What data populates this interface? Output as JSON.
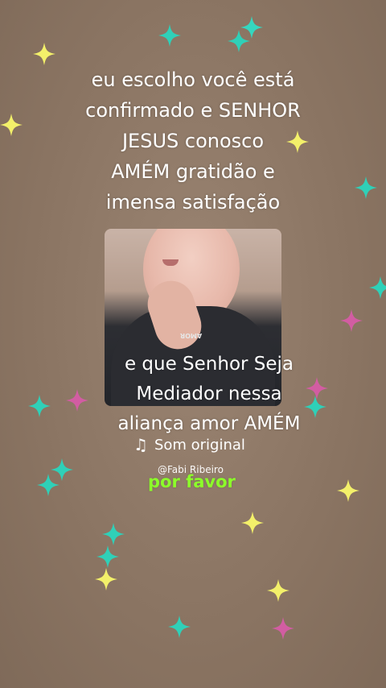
{
  "overlay_text": {
    "top": [
      "eu escolho você está",
      "confirmado e SENHOR",
      "JESUS conosco",
      "AMÉM gratidão e",
      "imensa satisfação"
    ],
    "bottom": [
      "e que Senhor Seja",
      "Mediador nessa",
      "aliança amor AMÉM"
    ],
    "please": "por favor"
  },
  "sound": {
    "icon": "music-note-icon",
    "label": "Som original"
  },
  "creator": {
    "username": "@Fabi Ribeiro"
  },
  "photo": {
    "shirt_text": "AMOR"
  },
  "colors": {
    "background": "#8e7866",
    "text": "#ffffff",
    "please_text": "#8cff2a",
    "sparkle_teal": "#2fd0b8",
    "sparkle_yellow": "#f3f06a",
    "sparkle_pink": "#d25da2"
  }
}
